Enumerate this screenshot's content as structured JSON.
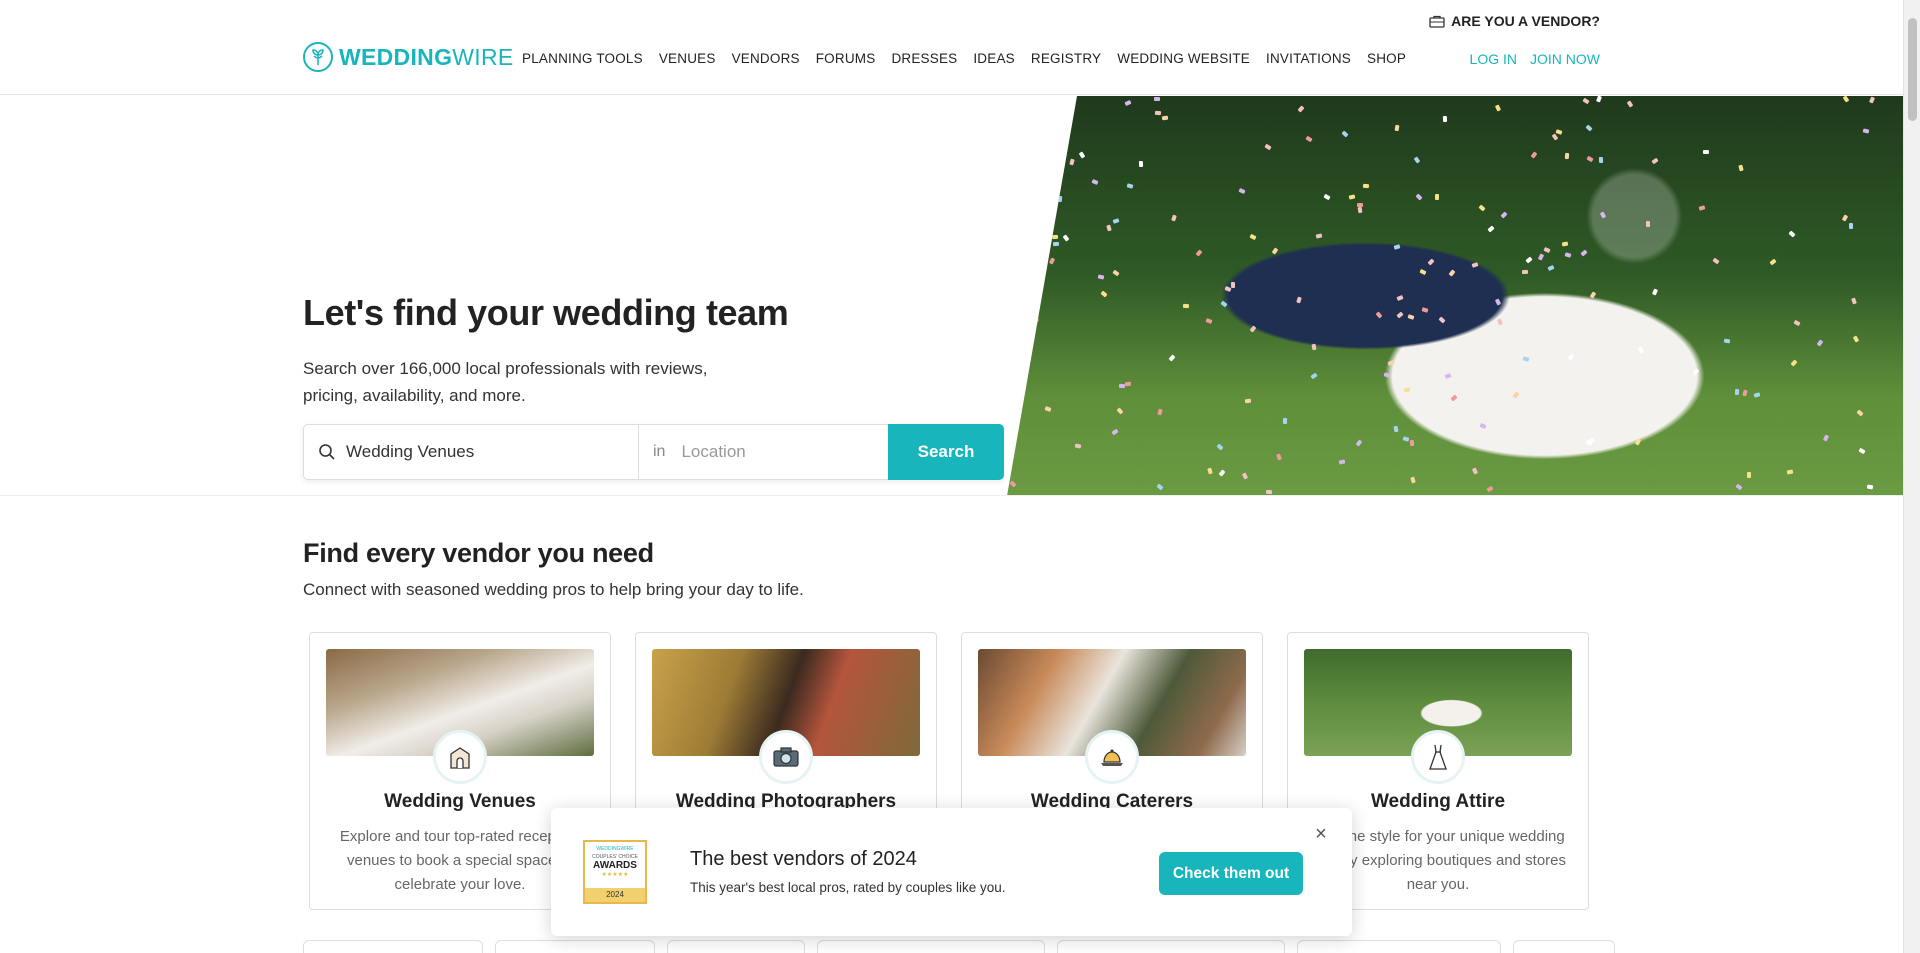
{
  "header": {
    "vendor_question": "ARE YOU A VENDOR?",
    "logo": {
      "part1": "WEDDING",
      "part2": "WIRE"
    },
    "nav": [
      "PLANNING TOOLS",
      "VENUES",
      "VENDORS",
      "FORUMS",
      "DRESSES",
      "IDEAS",
      "REGISTRY",
      "WEDDING WEBSITE",
      "INVITATIONS",
      "SHOP"
    ],
    "login": "LOG IN",
    "join": "JOIN NOW"
  },
  "hero": {
    "title": "Let's find your wedding team",
    "subtitle": "Search over 166,000 local professionals with reviews, pricing, availability, and more.",
    "search": {
      "what_value": "Wedding Venues",
      "in_label": "in",
      "location_placeholder": "Location",
      "button": "Search"
    }
  },
  "vendors_section": {
    "title": "Find every vendor you need",
    "subtitle": "Connect with seasoned wedding pros to help bring your day to life.",
    "cards": [
      {
        "title": "Wedding Venues",
        "desc": "Explore and tour top-rated reception venues to book a special space to celebrate your love.",
        "icon": "venue-icon"
      },
      {
        "title": "Wedding Photographers",
        "desc": "",
        "icon": "camera-icon"
      },
      {
        "title": "Wedding Caterers",
        "desc": "",
        "icon": "catering-icon"
      },
      {
        "title": "Wedding Attire",
        "desc": "Find the style for your unique wedding look by exploring boutiques and stores near you.",
        "icon": "dress-icon"
      }
    ]
  },
  "popup": {
    "badge": {
      "brand": "WEDDINGWIRE",
      "line1": "COUPLES' CHOICE",
      "line2": "AWARDS",
      "stars": "★★★★★",
      "year": "2024"
    },
    "title": "The best vendors of 2024",
    "subtitle": "This year's best local pros, rated by couples like you.",
    "button": "Check them out",
    "close": "×"
  },
  "colors": {
    "accent": "#19b5bc"
  }
}
